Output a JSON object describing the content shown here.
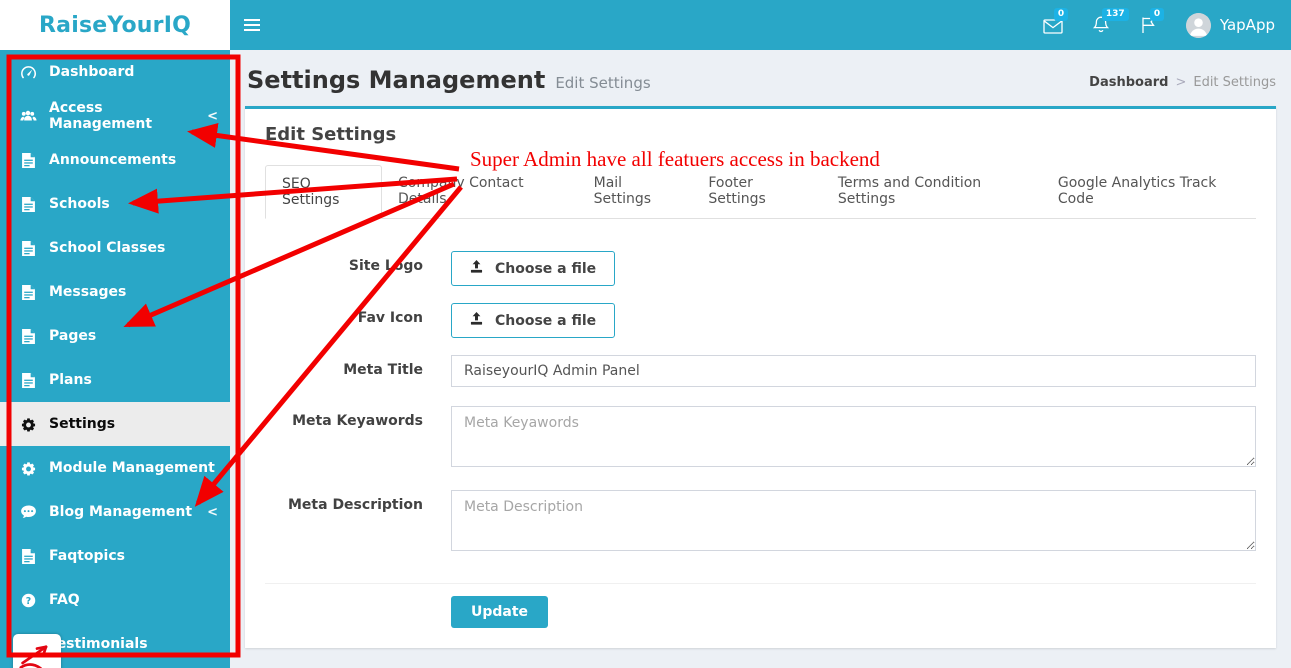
{
  "brand": {
    "logo_text": "RaiseYourIQ"
  },
  "topbar": {
    "user_name": "YapApp",
    "messages_badge": "0",
    "notifications_badge": "137",
    "flags_badge": "0",
    "icons": [
      "envelope-icon",
      "bell-icon",
      "flag-icon",
      "avatar"
    ]
  },
  "sidebar": {
    "items": [
      {
        "label": "Dashboard",
        "icon": "gauge-icon",
        "active": false
      },
      {
        "label": "Access Management",
        "icon": "users-icon",
        "active": false,
        "chevron": "<"
      },
      {
        "label": "Announcements",
        "icon": "file-icon",
        "active": false
      },
      {
        "label": "Schools",
        "icon": "file-icon",
        "active": false
      },
      {
        "label": "School Classes",
        "icon": "file-icon",
        "active": false
      },
      {
        "label": "Messages",
        "icon": "file-icon",
        "active": false
      },
      {
        "label": "Pages",
        "icon": "file-icon",
        "active": false
      },
      {
        "label": "Plans",
        "icon": "file-icon",
        "active": false
      },
      {
        "label": "Settings",
        "icon": "gear-icon",
        "active": true
      },
      {
        "label": "Module Management",
        "icon": "gear-icon",
        "active": false
      },
      {
        "label": "Blog Management",
        "icon": "comment-icon",
        "active": false,
        "chevron": "<"
      },
      {
        "label": "Faqtopics",
        "icon": "file-icon",
        "active": false
      },
      {
        "label": "FAQ",
        "icon": "question-circle-icon",
        "active": false
      },
      {
        "label": "Testimonials",
        "icon": "question-circle-icon",
        "active": false
      }
    ]
  },
  "content": {
    "page_title": "Settings Management",
    "page_subtitle": "Edit Settings",
    "breadcrumb": {
      "home": "Dashboard",
      "separator": ">",
      "current": "Edit Settings"
    },
    "card": {
      "title": "Edit Settings",
      "tabs": [
        "SEO Settings",
        "Company Contact Details",
        "Mail Settings",
        "Footer Settings",
        "Terms and Condition Settings",
        "Google Analytics Track Code"
      ],
      "active_tab": "SEO Settings",
      "form": {
        "fields": [
          {
            "label": "Site Logo",
            "control": "file",
            "button_label": "Choose a file"
          },
          {
            "label": "Fav Icon",
            "control": "file",
            "button_label": "Choose a file"
          },
          {
            "label": "Meta Title",
            "control": "input",
            "value": "RaiseyourIQ Admin Panel"
          },
          {
            "label": "Meta Keyawords",
            "control": "textarea",
            "placeholder": "Meta Keyawords"
          },
          {
            "label": "Meta Description",
            "control": "textarea",
            "placeholder": "Meta Description"
          }
        ],
        "submit_label": "Update"
      }
    }
  },
  "annotation": {
    "note": "Super Admin have all featuers access in backend",
    "color": "#F20000",
    "highlight_box": "sidebar",
    "arrow_targets": [
      "Access Management",
      "Schools",
      "Pages",
      "Blog Management"
    ]
  },
  "colors": {
    "accent_teal": "#29A7C7",
    "badge_blue": "#1CB2E5",
    "content_bg": "#ECF0F5",
    "active_item_bg": "#ECECEC"
  }
}
